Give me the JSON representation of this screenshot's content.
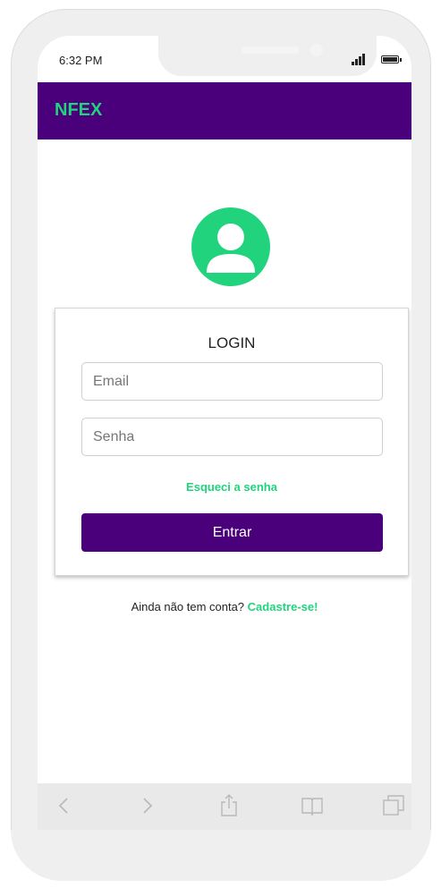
{
  "status_bar": {
    "time": "6:32 PM"
  },
  "header": {
    "brand": "NFEX"
  },
  "login": {
    "title": "LOGIN",
    "email_placeholder": "Email",
    "password_placeholder": "Senha",
    "forgot_label": "Esqueci a senha",
    "submit_label": "Entrar"
  },
  "signup": {
    "prompt": "Ainda não tem conta?",
    "link_label": "Cadastre-se!"
  },
  "browser_toolbar": {
    "icons": [
      "back-icon",
      "forward-icon",
      "share-icon",
      "bookmarks-icon",
      "tabs-icon"
    ]
  },
  "colors": {
    "brand_purple": "#4a007a",
    "accent_green": "#21d37c"
  }
}
